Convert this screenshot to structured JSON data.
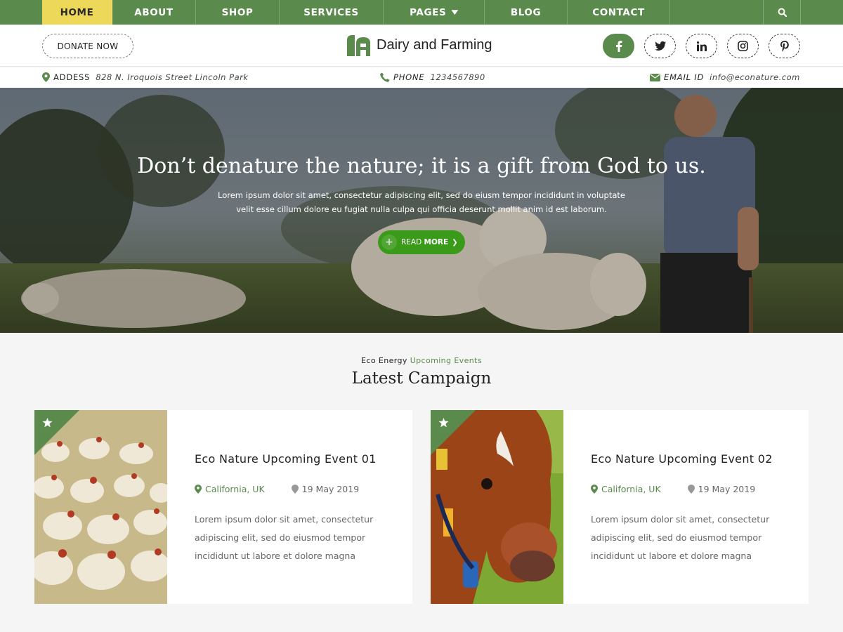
{
  "nav": {
    "items": [
      {
        "label": "HOME",
        "active": true
      },
      {
        "label": "ABOUT"
      },
      {
        "label": "SHOP"
      },
      {
        "label": "SERVICES"
      },
      {
        "label": "PAGES",
        "dropdown": true
      },
      {
        "label": "BLOG"
      },
      {
        "label": "CONTACT"
      }
    ],
    "search_icon": "search-icon"
  },
  "header": {
    "donate_label": "DONATE NOW",
    "logo_text": "Dairy and Farming",
    "socials": [
      "facebook-icon",
      "twitter-icon",
      "linkedin-icon",
      "instagram-icon",
      "pinterest-icon"
    ]
  },
  "info": {
    "address_label": "ADDESS",
    "address_value": "828 N. Iroquois Street Lincoln Park",
    "phone_label": "PHONE",
    "phone_value": "1234567890",
    "email_label": "EMAIL ID",
    "email_value": "info@econature.com"
  },
  "hero": {
    "title": "Don’t denature the nature; it is a gift from God to us.",
    "subtitle_line1": "Lorem ipsum dolor sit amet, consectetur adipiscing elit, sed do eiusm tempor incididunt in voluptate",
    "subtitle_line2": "velit esse cillum dolore eu fugiat nulla culpa qui officia deserunt mollit anim id est laborum.",
    "button_prefix": "READ",
    "button_bold": "MORE"
  },
  "section": {
    "eyebrow_plain": "Eco Energy",
    "eyebrow_green": "Upcoming Events",
    "title": "Latest Campaign"
  },
  "cards": [
    {
      "title": "Eco Nature Upcoming Event 01",
      "location": "California, UK",
      "date": "19 May 2019",
      "desc": "Lorem ipsum dolor sit amet, consectetur adipiscing elit, sed do eiusmod tempor incididunt ut labore et dolore magna"
    },
    {
      "title": "Eco Nature Upcoming Event 02",
      "location": "California, UK",
      "date": "19 May 2019",
      "desc": "Lorem ipsum dolor sit amet, consectetur adipiscing elit, sed do eiusmod tempor incididunt ut labore et dolore magna"
    }
  ],
  "colors": {
    "brand_green": "#5a8b4c",
    "active_yellow": "#eed85a",
    "button_green": "#3a9a1a"
  }
}
